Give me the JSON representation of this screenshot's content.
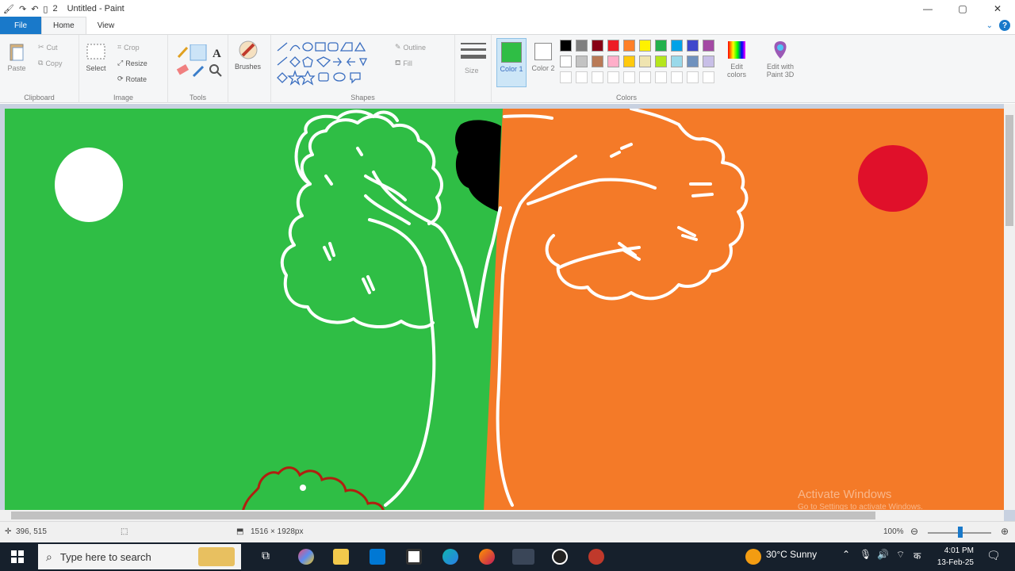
{
  "window": {
    "title": "Untitled - Paint",
    "qat_number": "2"
  },
  "tabs": [
    {
      "label": "File"
    },
    {
      "label": "Home"
    },
    {
      "label": "View"
    }
  ],
  "ribbon": {
    "clipboard": {
      "paste": "Paste",
      "cut": "Cut",
      "copy": "Copy",
      "label": "Clipboard"
    },
    "image": {
      "select": "Select",
      "crop": "Crop",
      "resize": "Resize",
      "rotate": "Rotate",
      "label": "Image"
    },
    "tools": {
      "label": "Tools"
    },
    "brushes": {
      "label": "Brushes"
    },
    "shapes": {
      "outline": "Outline",
      "fill": "Fill",
      "label": "Shapes"
    },
    "size": {
      "label": "Size"
    },
    "colors": {
      "color1": "Color 1",
      "color2": "Color 2",
      "edit_colors": "Edit colors",
      "edit_paint3d": "Edit with Paint 3D",
      "label": "Colors",
      "color1_value": "#2fbe45",
      "color2_value": "#ffffff",
      "palette": [
        "#000000",
        "#7f7f7f",
        "#880015",
        "#ed1c24",
        "#ff7f27",
        "#fff200",
        "#22b14c",
        "#00a2e8",
        "#3f48cc",
        "#a349a4",
        "#ffffff",
        "#c3c3c3",
        "#b97a57",
        "#ffaec9",
        "#ffc90e",
        "#efe4b0",
        "#b5e61d",
        "#99d9ea",
        "#7092be",
        "#c8bfe7"
      ]
    }
  },
  "canvas": {
    "left_color": "#2fbe45",
    "right_color": "#f47a28",
    "moon_color": "#ffffff",
    "sun_color": "#e0102a"
  },
  "status": {
    "cursor": "396, 515",
    "size": "1516 × 1928px",
    "zoom": "100%"
  },
  "watermark": {
    "line1": "Activate Windows",
    "line2": "Go to Settings to activate Windows."
  },
  "taskbar": {
    "search_placeholder": "Type here to search",
    "weather": "30°C  Sunny",
    "time": "4:01 PM",
    "date": "13-Feb-25"
  }
}
